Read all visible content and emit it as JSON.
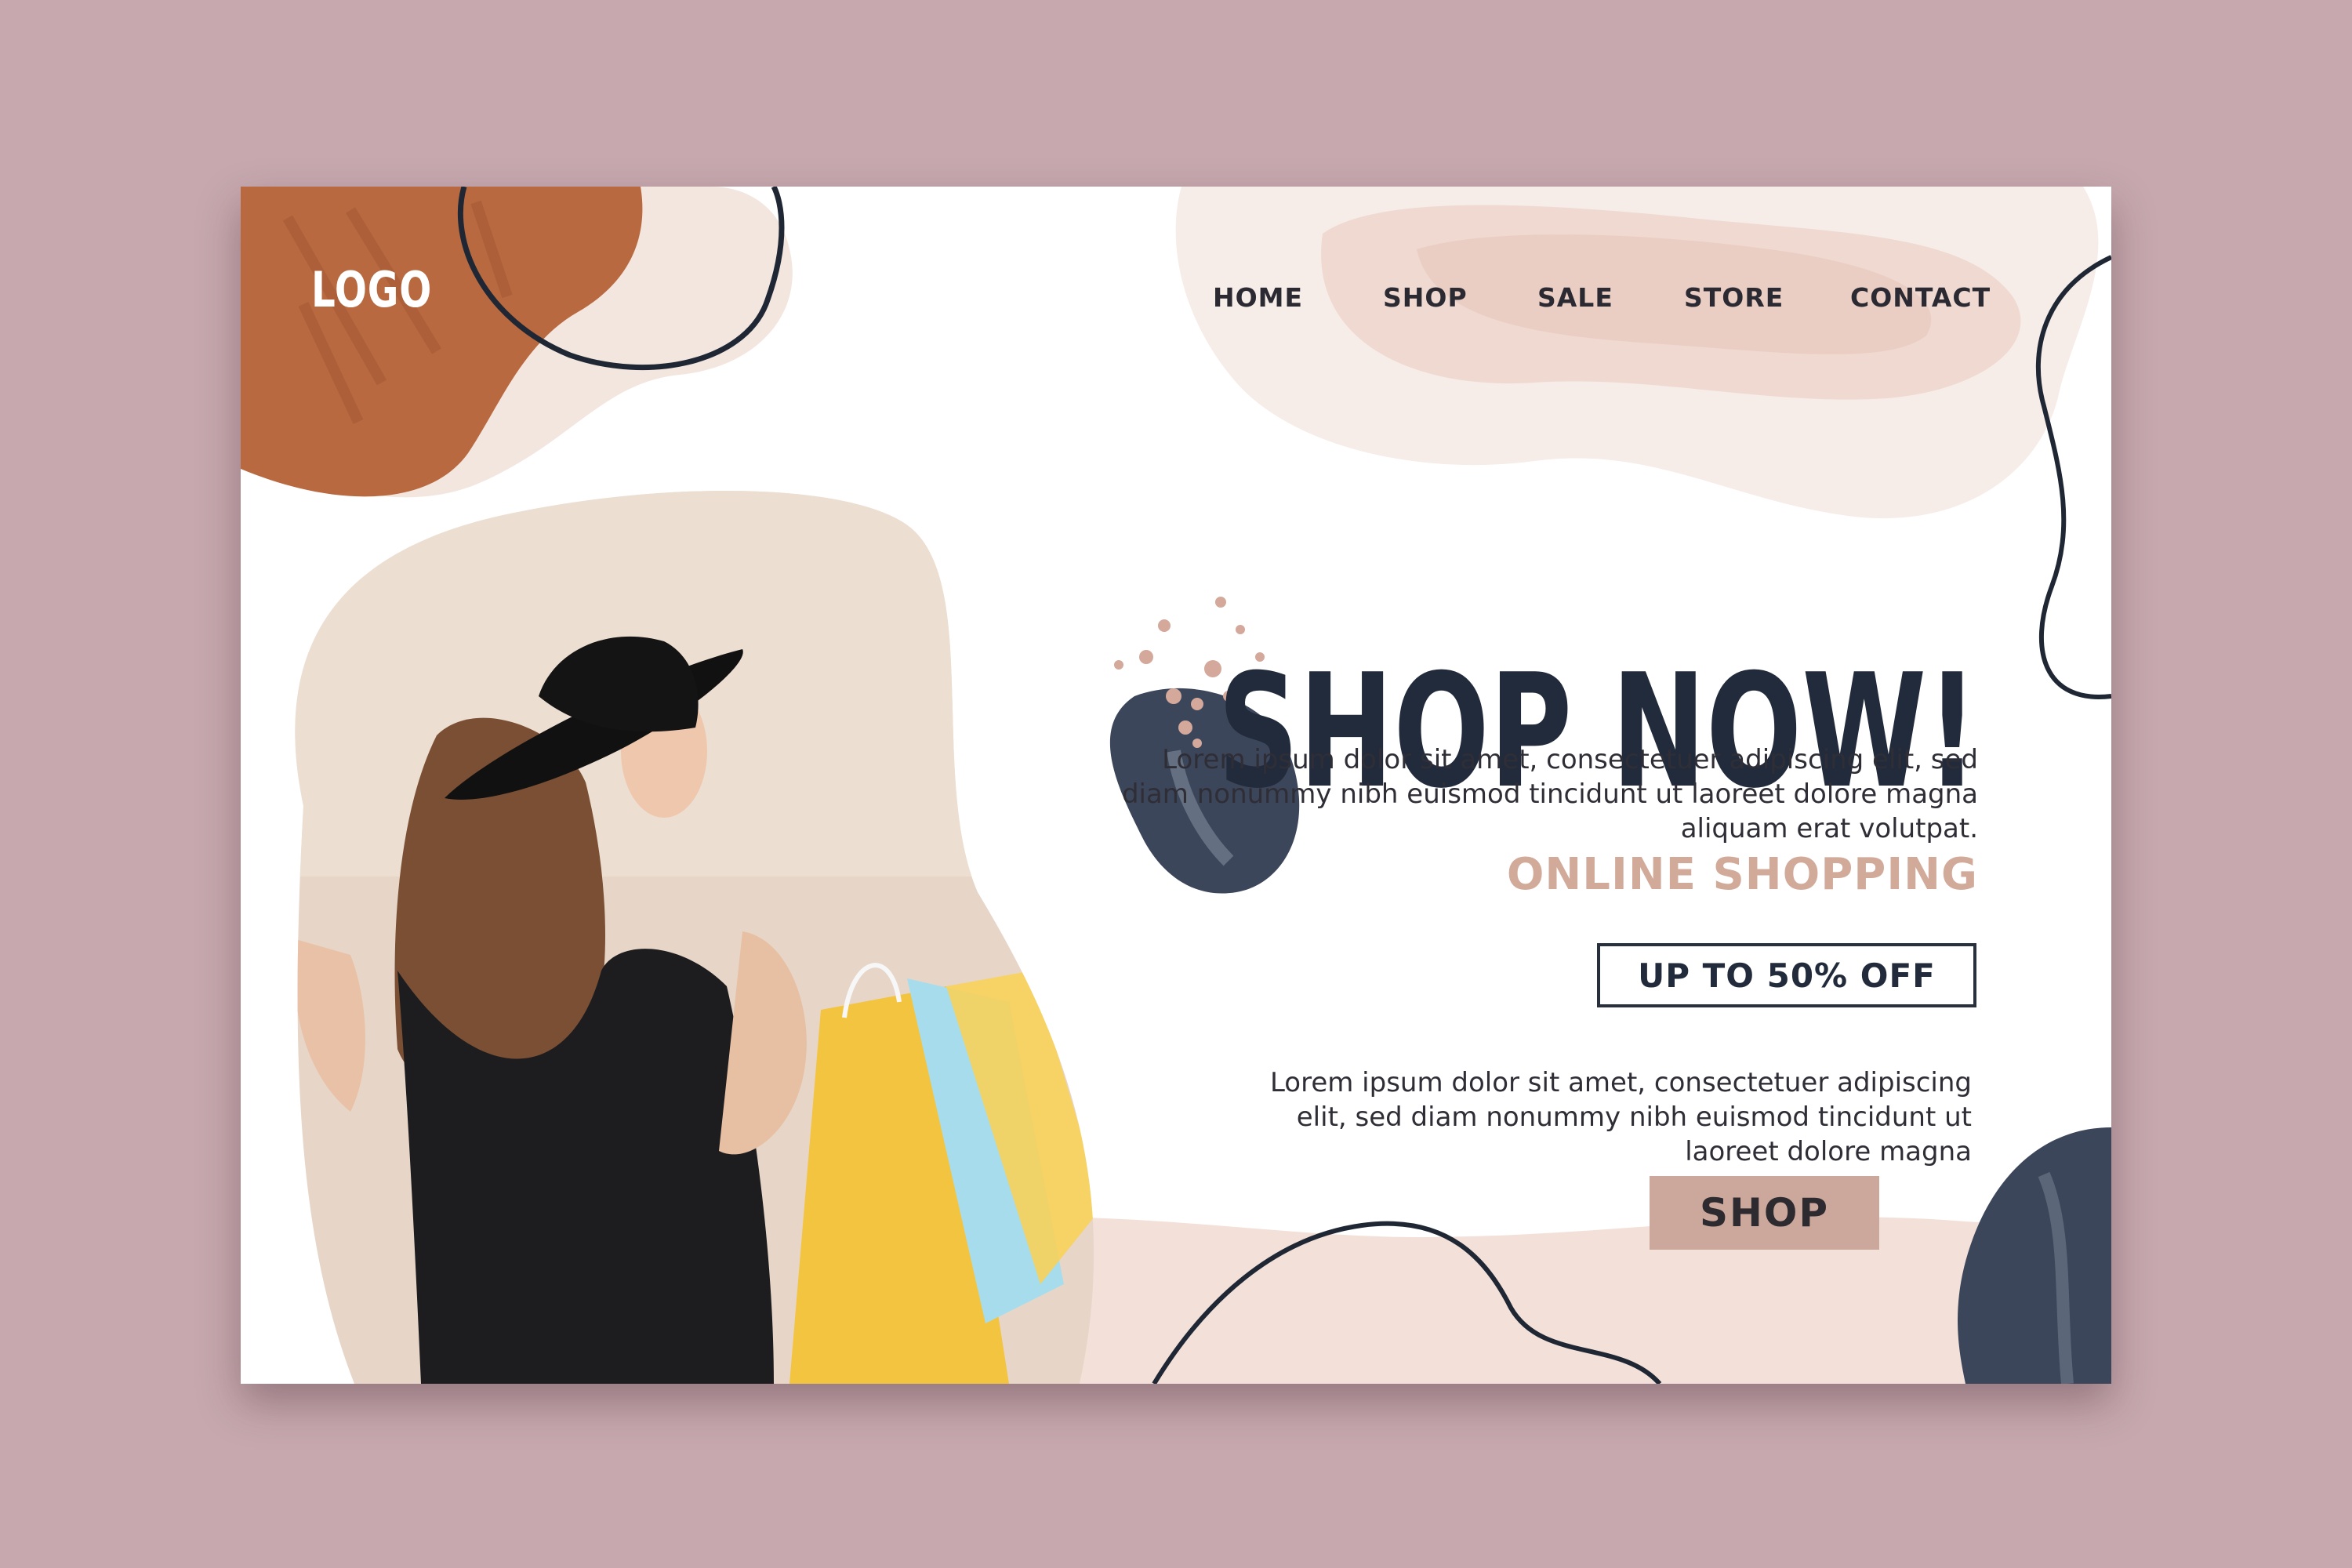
{
  "brand": {
    "logo": "LOGO"
  },
  "nav": {
    "items": [
      {
        "label": "HOME"
      },
      {
        "label": "SHOP"
      },
      {
        "label": "SALE"
      },
      {
        "label": "STORE"
      },
      {
        "label": "CONTACT"
      }
    ]
  },
  "hero": {
    "headline": "SHOP NOW!",
    "paragraph_1": "Lorem ipsum dolor sit amet, consectetuer adipiscing elit, sed diam nonummy nibh euismod tincidunt ut laoreet dolore magna aliquam erat volutpat.",
    "subheading": "ONLINE SHOPPING",
    "badge": "UP TO 50% OFF",
    "paragraph_2": "Lorem ipsum dolor sit amet, consectetuer adipiscing elit, sed diam nonummy nibh euismod tincidunt ut laoreet dolore magna",
    "cta_label": "SHOP"
  },
  "colors": {
    "page_background": "#c6a8ae",
    "card_background": "#ffffff",
    "headline": "#222b3b",
    "accent_peach": "#d1aa9a",
    "button": "#cba89b",
    "brown_blob": "#b8693f",
    "navy_blob": "#3c465a"
  },
  "images": {
    "hero_photo": "woman-in-black-hat-holding-shopping-bags"
  }
}
